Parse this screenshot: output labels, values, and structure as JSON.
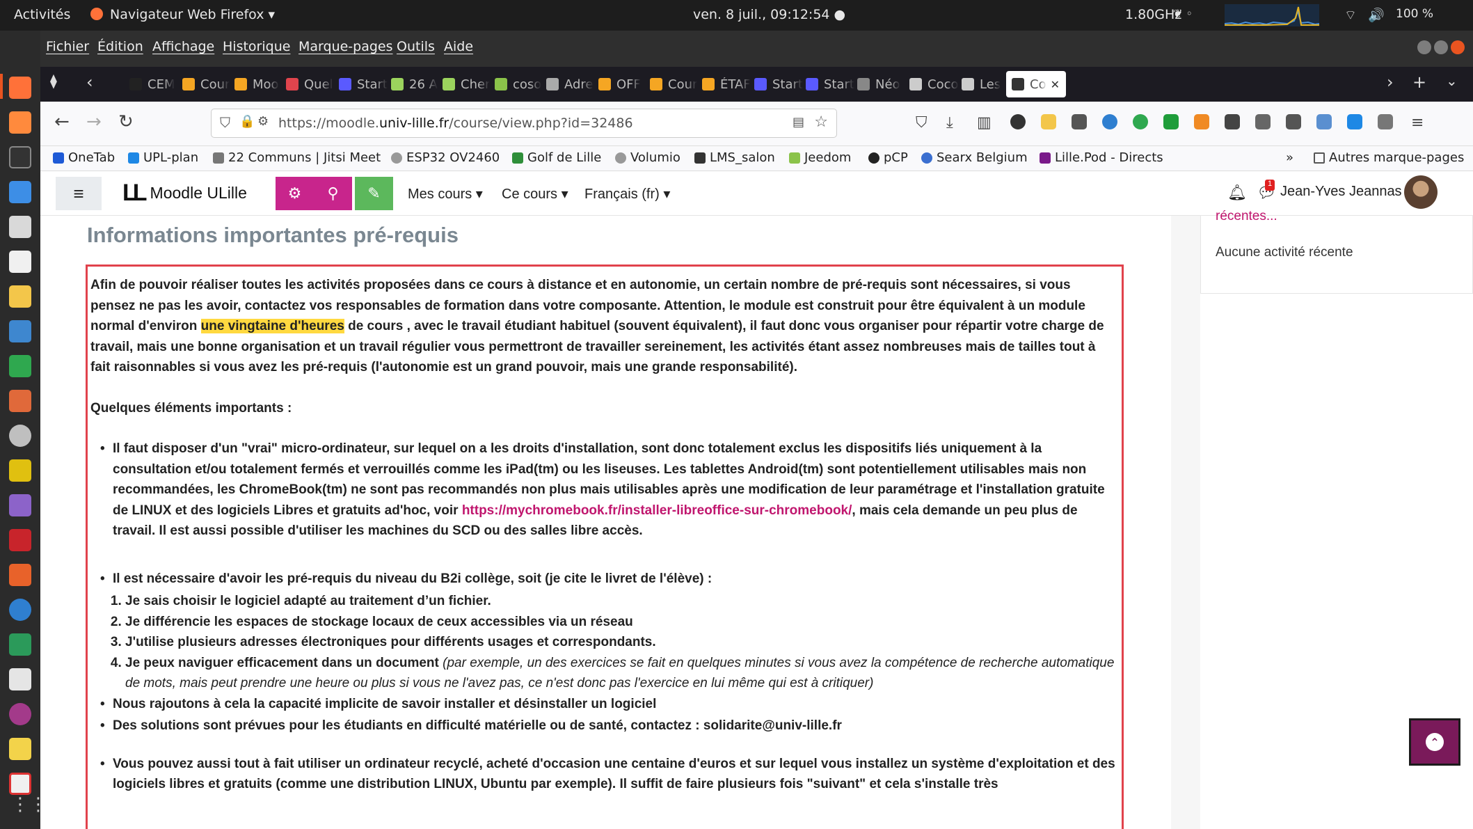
{
  "system": {
    "activities": "Activités",
    "app": "Navigateur Web Firefox ▾",
    "clock": "ven.  8 juil., 09:12:54 ●",
    "cpu": "1.80GHz",
    "battery": "100 %"
  },
  "menu": [
    "Fichier",
    "Édition",
    "Affichage",
    "Historique",
    "Marque-pages",
    "Outils",
    "Aide"
  ],
  "tabs": [
    {
      "label": "CEM",
      "color": "#222"
    },
    {
      "label": "Cour",
      "color": "#f5a623"
    },
    {
      "label": "Moo",
      "color": "#f5a623"
    },
    {
      "label": "Quel",
      "color": "#e0444d"
    },
    {
      "label": "Start",
      "color": "#5a5aff"
    },
    {
      "label": "26 A",
      "color": "#9bd35d"
    },
    {
      "label": "Cher",
      "color": "#9bd35d"
    },
    {
      "label": "coso",
      "color": "#8bc34a"
    },
    {
      "label": "Adre",
      "color": "#aaa"
    },
    {
      "label": "OFF",
      "color": "#f5a623"
    },
    {
      "label": "Cour",
      "color": "#f5a623"
    },
    {
      "label": "ÉTAF",
      "color": "#f5a623"
    },
    {
      "label": "Start",
      "color": "#5a5aff"
    },
    {
      "label": "Start",
      "color": "#5a5aff"
    },
    {
      "label": "Néo",
      "color": "#888"
    },
    {
      "label": "Coco",
      "color": "#ccc"
    },
    {
      "label": "Les",
      "color": "#ccc"
    },
    {
      "label": "Co",
      "color": "#333"
    }
  ],
  "url": {
    "prefix": "https://moodle.",
    "host": "univ-lille.fr",
    "path": "/course/view.php?id=32486"
  },
  "bookmarks": [
    "OneTab",
    "UPL-plan",
    "22 Communs | Jitsi Meet",
    "ESP32 OV2460",
    "Golf de Lille",
    "Volumio",
    "LMS_salon",
    "Jeedom",
    "pCP",
    "Searx Belgium",
    "Lille.Pod - Directs"
  ],
  "bookmarks_more": "Autres marque-pages",
  "moodle": {
    "logo": "Moodle ULille",
    "menus": [
      "Mes cours ▾",
      "Ce cours ▾",
      "Français (fr) ▾"
    ],
    "user": "Jean-Yves Jeannas ▾",
    "badge": "1"
  },
  "page": {
    "heading": "Informations importantes pré-requis",
    "intro_a": "Afin de pouvoir réaliser toutes les activités proposées dans ce cours à distance et en autonomie, un certain nombre de pré-requis sont nécessaires, si vous pensez ne pas les avoir, contactez vos responsables de formation dans votre composante. Attention, le module est construit pour être équivalent à un module normal d'environ ",
    "intro_hl": "une vingtaine d'heures",
    "intro_b": " de cours , avec le travail étudiant habituel (souvent équivalent), il faut donc vous organiser pour répartir votre charge de travail, mais une bonne organisation et un travail régulier vous permettront de travailler sereinement, les activités étant assez nombreuses mais de tailles tout à fait raisonnables si vous avez les pré-requis (l'autonomie est un grand pouvoir, mais une grande responsabilité).",
    "elements_title": "Quelques éléments importants :",
    "b1_a": "Il faut disposer d'un \"vrai\" micro-ordinateur, sur lequel on a les droits d'installation, sont donc totalement exclus les dispositifs liés uniquement à la consultation et/ou totalement fermés et verrouillés comme les iPad(tm) ou les liseuses. Les tablettes Android(tm) sont potentiellement  utilisables mais non recommandées, les ChromeBook(tm) ne sont pas recommandés non plus mais utilisables après une modification de leur paramétrage et l'installation gratuite de LINUX et des logiciels Libres et gratuits ad'hoc, voir ",
    "b1_link": "https://mychromebook.fr/installer-libreoffice-sur-chromebook/",
    "b1_b": ", mais cela demande un peu plus de travail. Il est aussi possible d'utiliser les machines du SCD ou des salles libre accès.",
    "b2": "Il est nécessaire d'avoir les pré-requis du niveau du B2i collège, soit (je cite le livret de l'élève) :",
    "ol": [
      "Je sais choisir le logiciel adapté au traitement d’un fichier.",
      "Je différencie les espaces de stockage locaux de ceux accessibles via un réseau",
      "J'utilise plusieurs adresses électroniques pour différents usages et correspondants.",
      "Je peux naviguer efficacement dans un document"
    ],
    "ol4_em": " (par exemple, un des exercices se fait en quelques minutes si vous avez la compétence de recherche automatique de mots, mais peut prendre une heure ou plus si vous ne l'avez pas, ce n'est donc pas l'exercice en lui même qui est à critiquer)",
    "b3": "Nous rajoutons à cela la capacité implicite de savoir installer et désinstaller un logiciel",
    "b4": "Des solutions sont prévues pour les étudiants en difficulté matérielle ou de santé, contactez : solidarite@univ-lille.fr",
    "b5": "Vous pouvez aussi tout à fait utiliser un ordinateur recyclé, acheté d'occasion une centaine d'euros et sur lequel vous installez un système d'exploitation et des logiciels libres et gratuits (comme une distribution LINUX, Ubuntu par exemple). Il suffit de faire plusieurs fois \"suivant\" et cela s'installe très"
  },
  "side": {
    "recent_link": "récentes...",
    "no_activity": "Aucune activité récente"
  }
}
